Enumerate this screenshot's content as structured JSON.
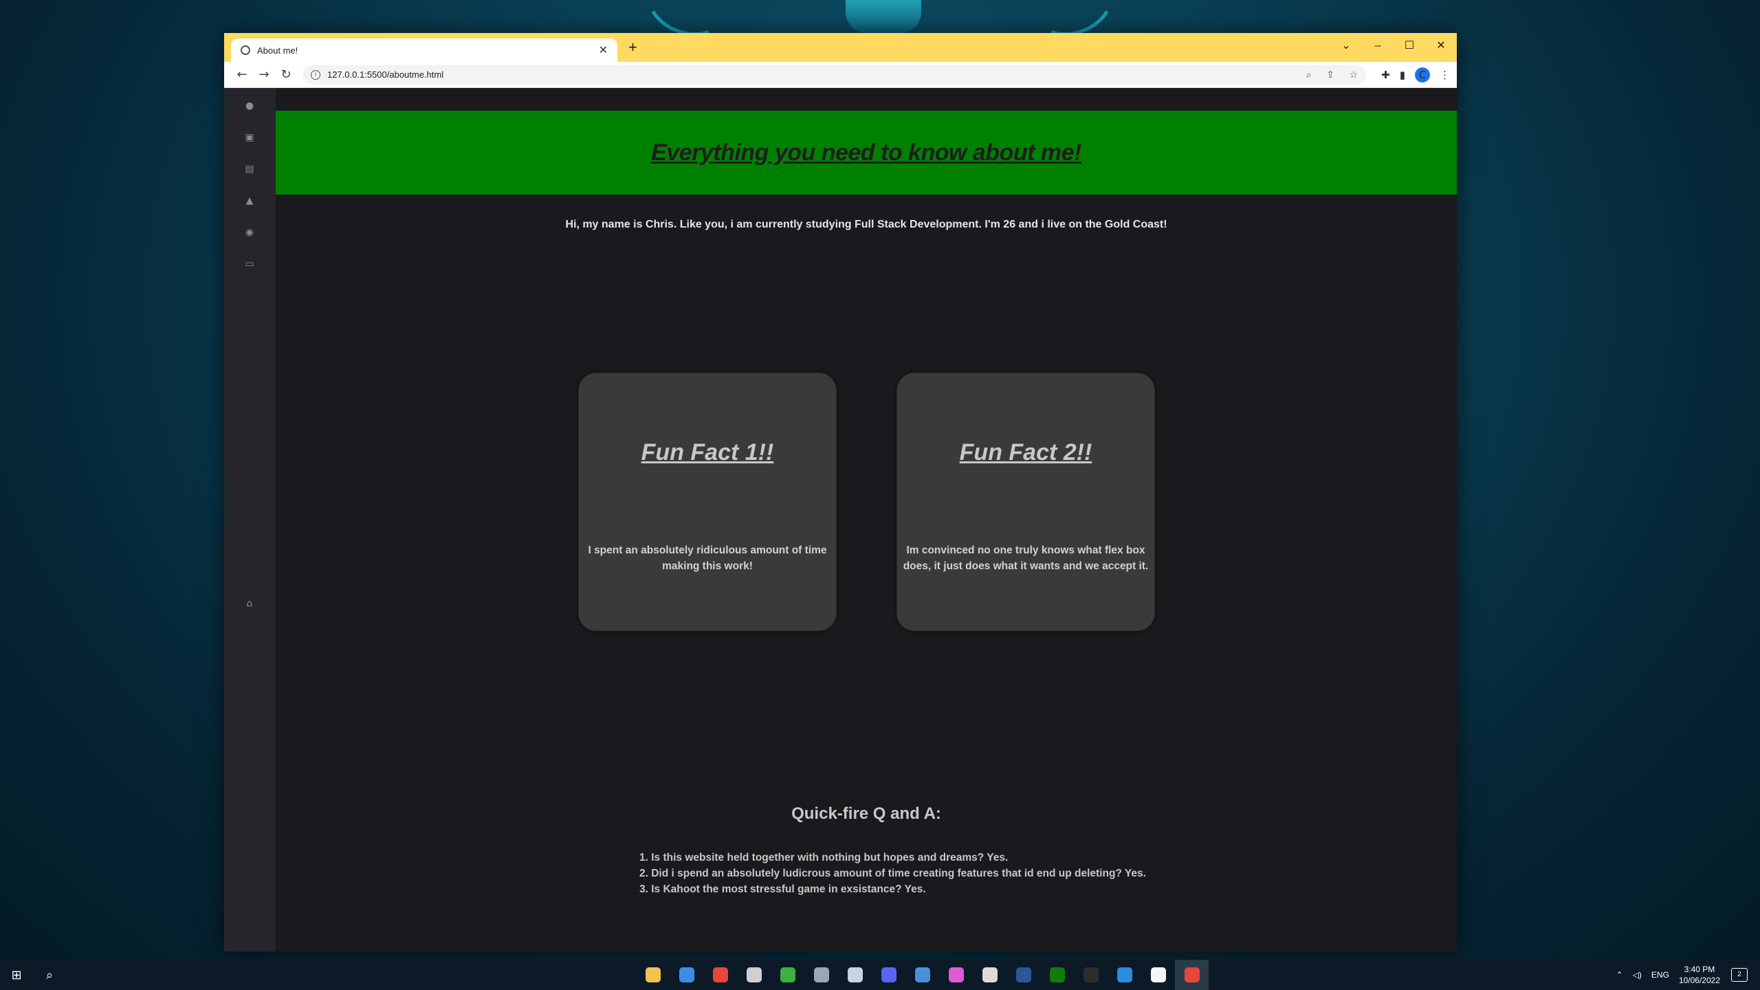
{
  "browser": {
    "tab_title": "About me!",
    "new_tab": "+",
    "url": "127.0.0.1:5500/aboutme.html",
    "window_controls": [
      "⌄",
      "–",
      "☐",
      "✕"
    ],
    "profile_initial": "C"
  },
  "sidebar": {
    "icons": [
      "github-icon",
      "linkedin-icon",
      "document-icon",
      "bell-icon",
      "steam-icon",
      "laptop-icon",
      "home-icon"
    ]
  },
  "page": {
    "banner_title": "Everything you need to know about me!",
    "intro": "Hi, my name is Chris. Like you, i am currently studying Full Stack Development. I'm 26 and i live on the Gold Coast!",
    "cards": [
      {
        "title": "Fun Fact 1!!",
        "text": "I spent an absolutely ridiculous amount of time making this work!"
      },
      {
        "title": "Fun Fact 2!!",
        "text": "Im convinced no one truly knows what flex box does, it just does what it wants and we accept it."
      }
    ],
    "qa_title": "Quick-fire Q and A:",
    "qa_items": [
      "1. Is this website held together with nothing but hopes and dreams? Yes.",
      "2. Did i spend an absolutely ludicrous amount of time creating features that id end up deleting? Yes.",
      "3. Is Kahoot the most stressful game in exsistance? Yes."
    ]
  },
  "taskbar": {
    "apps": [
      "file-explorer",
      "mail",
      "chrome",
      "chrome-alt",
      "xbox-green",
      "app-gray",
      "steam",
      "discord",
      "app-blue",
      "itunes",
      "app-cloud",
      "word",
      "xbox",
      "terminal",
      "vscode",
      "app-face",
      "chrome-active"
    ],
    "app_colors": [
      "#f2c14e",
      "#3a8ee6",
      "#e8453c",
      "#cfcfcf",
      "#3cb043",
      "#9aa6b2",
      "#c7d5e0",
      "#5865f2",
      "#4a90d9",
      "#e05ad6",
      "#dcdcdc",
      "#2b579a",
      "#107c10",
      "#2d2d2d",
      "#2a8de0",
      "#f5f5f5",
      "#e8453c"
    ],
    "tray_lang": "ENG",
    "time": "3:40 PM",
    "date": "10/06/2022",
    "notification_count": "2"
  },
  "colors": {
    "banner": "#008000",
    "titlebar": "#ffd960",
    "page_bg": "#1a191e",
    "card_bg": "#3a3a3a"
  }
}
